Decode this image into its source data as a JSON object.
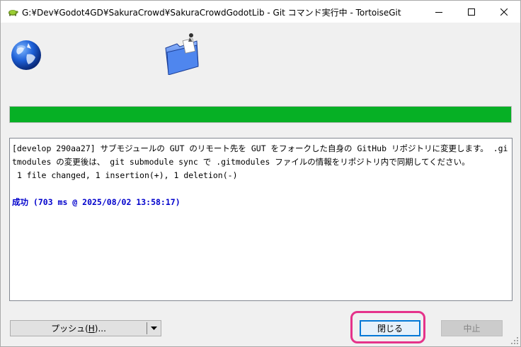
{
  "window": {
    "title": "G:¥Dev¥Godot4GD¥SakuraCrowd¥SakuraCrowdGodotLib - Git コマンド実行中 - TortoiseGit",
    "app_icon": "tortoise-icon"
  },
  "icons": {
    "left": "globe-icon",
    "right": "folder-icon"
  },
  "progress": {
    "fraction": 1.0,
    "color": "#06b025"
  },
  "log": {
    "lines": [
      "[develop 290aa27] サブモジュールの GUT のリモート先を GUT をフォークした自身の GitHub リポジトリに変更します。 .gitmodules の変更後は、 git submodule sync で .gitmodules ファイルの情報をリポジトリ内で同期してください。",
      " 1 file changed, 1 insertion(+), 1 deletion(-)"
    ],
    "success": "成功 (703 ms @ 2025/08/02 13:58:17)",
    "success_color": "#0000cc"
  },
  "buttons": {
    "push_prefix": "プッシュ(",
    "push_key": "H",
    "push_suffix": ")...",
    "close": "閉じる",
    "abort": "中止"
  },
  "colors": {
    "highlight": "#e5328a",
    "focus": "#0078d7"
  }
}
